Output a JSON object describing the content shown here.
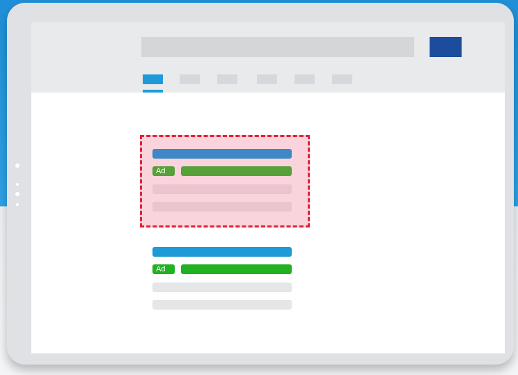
{
  "colors": {
    "background_top": "#1f8fd8",
    "tablet_frame": "#dfe1e4",
    "header_bg": "#e9eaec",
    "search_button": "#1b4d9c",
    "active_tab": "#1f9ad8",
    "tab_inactive": "#d7d8db",
    "highlight_border": "#e32238",
    "highlight_fill": "#f9d4dc",
    "sponsored_title_bar": "#3f88c5",
    "sponsored_ad_green": "#57a13a",
    "sponsored_line": "#ecc4cd",
    "organic_title_bar": "#1f9ad8",
    "organic_ad_green": "#21b121",
    "organic_line": "#e5e6e8"
  },
  "results": {
    "sponsored": {
      "ad_label": "Ad"
    },
    "second": {
      "ad_label": "Ad"
    }
  }
}
